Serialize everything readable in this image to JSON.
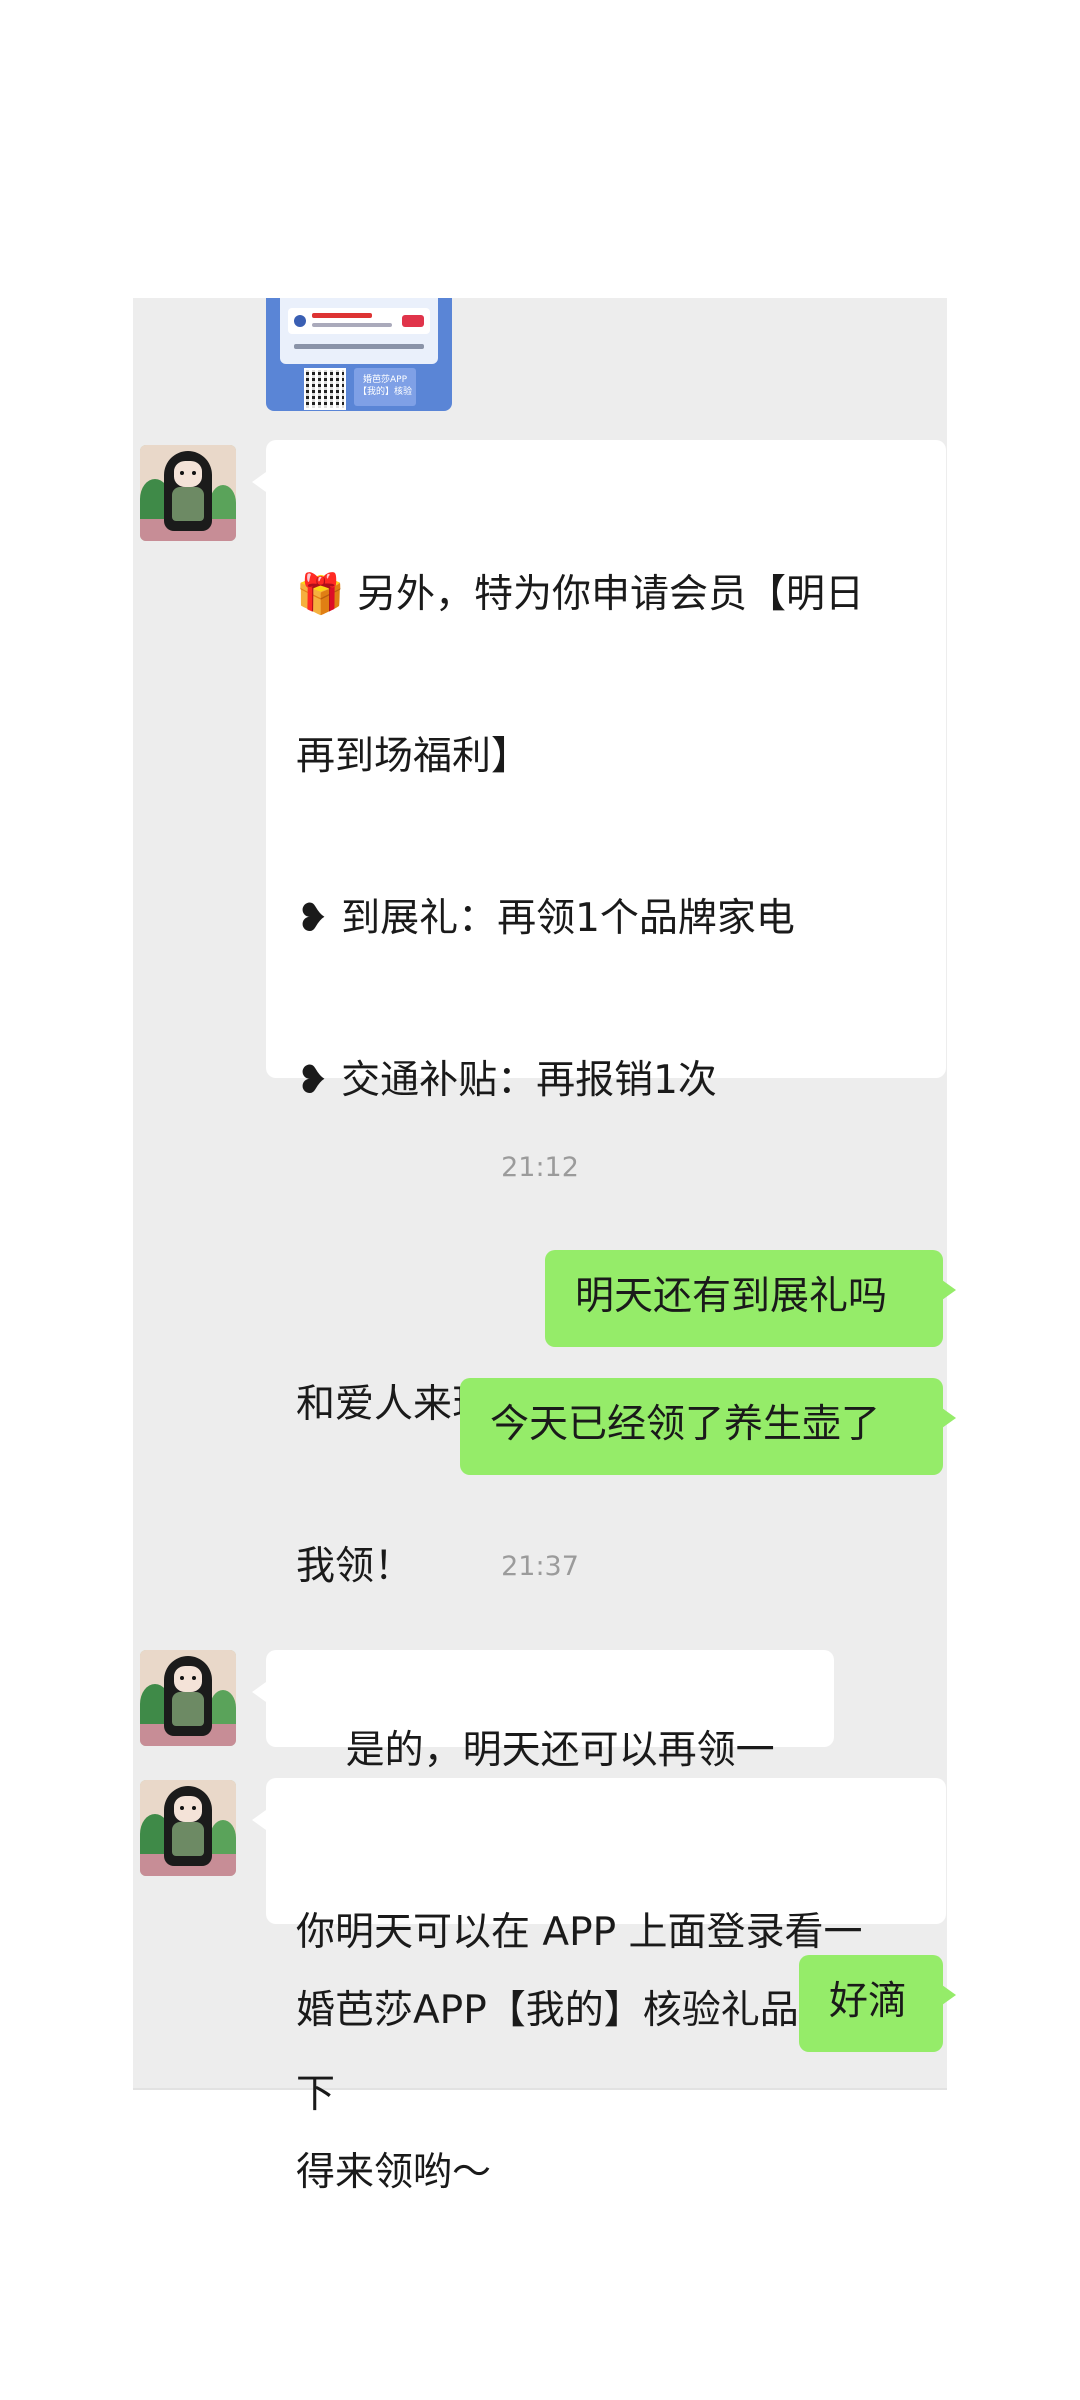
{
  "image_message": {
    "card_app_label": "婚芭莎APP\n【我的】核验"
  },
  "messages": {
    "m1": {
      "line1": "🎁 另外，特为你申请会员【明日",
      "line2": "再到场福利】",
      "line3": "❥ 到展礼：再领1个品牌家电",
      "line4": "❥ 交通补贴：再报销1次",
      "line5": "和爱人来现场＜会员服务中心＞找",
      "line6": "我领！",
      "divider": "———————————————",
      "line7": "婚芭莎APP【我的】核验礼品，记",
      "line8": "得来领哟～"
    },
    "ts1": "21:12",
    "m2": "明天还有到展礼吗",
    "m3": "今天已经领了养生壶了",
    "ts2": "21:37",
    "m4": "是的，明天还可以再领一个",
    "m5": {
      "line1": "你明天可以在 APP 上面登录看一",
      "line2": "下"
    },
    "m6": "好滴"
  },
  "colors": {
    "chat_background": "#ededed",
    "outgoing_bubble": "#95ec69",
    "incoming_bubble": "#ffffff",
    "timestamp_text": "#9b9b9b"
  }
}
